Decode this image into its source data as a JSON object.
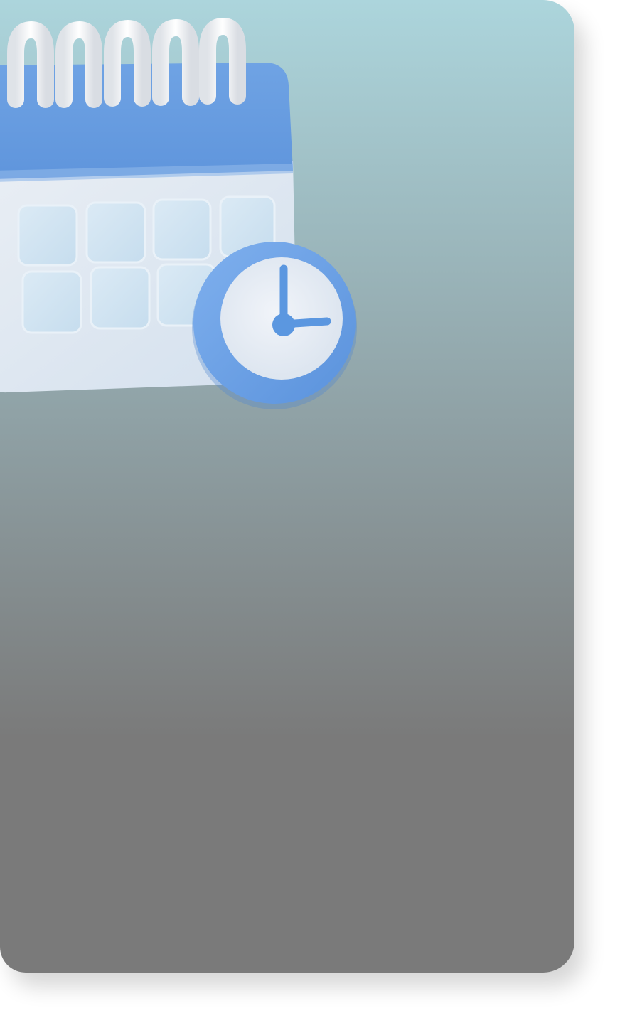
{
  "card": {
    "background_top": "#acd5dc",
    "background_mid": "#8e9fa3",
    "background_bottom": "#7a7a7a"
  },
  "illustration": {
    "calendar_icon": "calendar-icon",
    "clock_icon": "clock-icon",
    "calendar_header_color": "#6a9fe0",
    "calendar_body_color": "#dfe8f2",
    "calendar_cell_color": "#d3e6f3",
    "ring_color": "#f3f5f8",
    "clock_rim_color": "#6aa1e6",
    "clock_face_color": "#e7ecf4",
    "clock_hand_color": "#5b97e0",
    "calendar_rows": 2,
    "calendar_columns": 4
  }
}
